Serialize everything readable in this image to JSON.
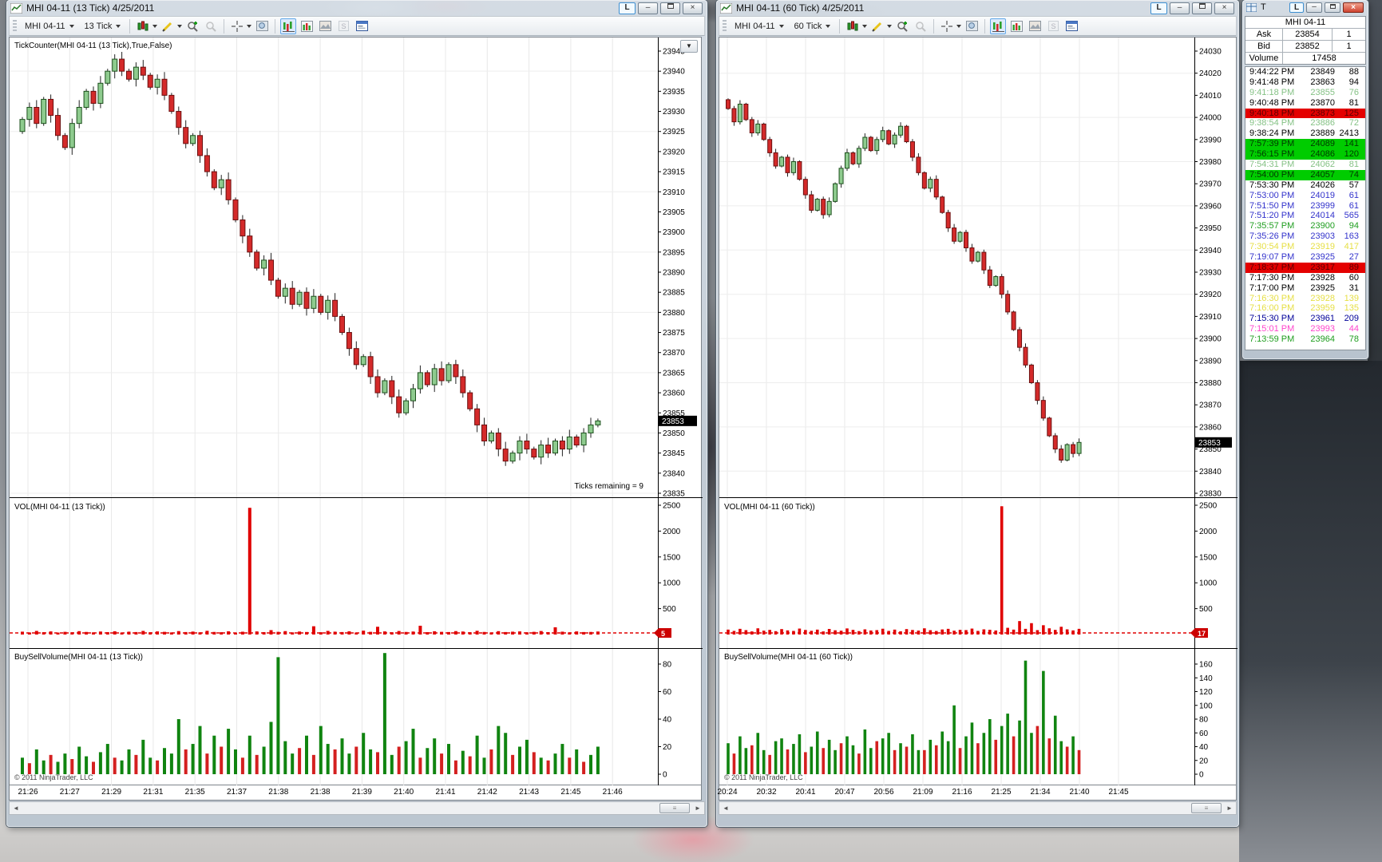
{
  "chrome": {
    "link_label": "L",
    "minimize_glyph": "–",
    "close_glyph": "×",
    "axis_menu_glyph": "▼",
    "scroll_left_glyph": "◄",
    "scroll_right_glyph": "►",
    "scroll_grip_glyph": "≡"
  },
  "colors": {
    "candle_up": "#8ecb8e",
    "candle_up_stroke": "#1c4f1c",
    "candle_down": "#d42a2a",
    "candle_down_stroke": "#6b0f0f",
    "wick": "#222222",
    "volume_bar": "#e00000",
    "buy_bar": "#108410",
    "sell_bar": "#d42020",
    "grid": "#e8e8e8",
    "price_badge_bg": "#000000",
    "vol_badge_bg": "#cc0000"
  },
  "left_chart": {
    "title": "MHI 04-11 (13 Tick)  4/25/2011",
    "toolbar": {
      "instrument": "MHI 04-11",
      "interval": "13 Tick"
    },
    "indicator_label": "TickCounter(MHI 04-11 (13 Tick),True,False)",
    "vol_label": "VOL(MHI 04-11 (13 Tick))",
    "bsv_label": "BuySellVolume(MHI 04-11 (13 Tick))",
    "ticks_remaining": "Ticks remaining = 9",
    "copyright": "© 2011 NinjaTrader, LLC",
    "price_axis": {
      "max": 23945,
      "min": 23835,
      "step": 5
    },
    "last_price": "23853",
    "vol_axis": {
      "max": 2500,
      "step": 500,
      "last": "5"
    },
    "bsv_axis": {
      "max": 80,
      "step": 20
    },
    "time_labels": [
      "21:26",
      "21:27",
      "21:29",
      "21:31",
      "21:35",
      "21:37",
      "21:38",
      "21:38",
      "21:39",
      "21:40",
      "21:41",
      "21:42",
      "21:43",
      "21:45",
      "21:46"
    ],
    "open_first": 23925,
    "closes": [
      23928,
      23931,
      23927,
      23933,
      23929,
      23924,
      23921,
      23927,
      23931,
      23935,
      23932,
      23937,
      23940,
      23943,
      23940,
      23938,
      23941,
      23939,
      23936,
      23938,
      23934,
      23930,
      23926,
      23922,
      23924,
      23919,
      23915,
      23911,
      23913,
      23908,
      23903,
      23899,
      23895,
      23891,
      23893,
      23888,
      23884,
      23886,
      23882,
      23885,
      23881,
      23884,
      23880,
      23883,
      23879,
      23875,
      23871,
      23867,
      23869,
      23864,
      23860,
      23863,
      23859,
      23855,
      23858,
      23861,
      23865,
      23862,
      23866,
      23863,
      23867,
      23864,
      23860,
      23856,
      23852,
      23848,
      23850,
      23846,
      23843,
      23845,
      23848,
      23846,
      23844,
      23847,
      23845,
      23848,
      23846,
      23849,
      23847,
      23850,
      23852,
      23853
    ],
    "volumes": [
      55,
      40,
      70,
      45,
      60,
      38,
      52,
      44,
      65,
      50,
      42,
      58,
      47,
      63,
      39,
      55,
      48,
      70,
      44,
      60,
      52,
      41,
      66,
      48,
      57,
      43,
      72,
      50,
      45,
      62,
      38,
      54,
      2450,
      60,
      47,
      85,
      52,
      66,
      42,
      58,
      49,
      160,
      45,
      70,
      55,
      48,
      62,
      40,
      75,
      52,
      150,
      60,
      44,
      68,
      50,
      58,
      170,
      46,
      63,
      52,
      48,
      66,
      58,
      45,
      72,
      50,
      40,
      65,
      48,
      55,
      60,
      44,
      52,
      68,
      47,
      140,
      55,
      42,
      60,
      48,
      50,
      58
    ],
    "bsv": [
      12,
      -8,
      18,
      10,
      -14,
      9,
      15,
      -11,
      20,
      13,
      -9,
      16,
      22,
      -12,
      10,
      18,
      -14,
      25,
      12,
      -10,
      19,
      15,
      40,
      -18,
      22,
      35,
      -15,
      28,
      -20,
      33,
      18,
      -12,
      28,
      -14,
      20,
      38,
      85,
      24,
      15,
      -19,
      28,
      -14,
      35,
      22,
      -18,
      26,
      15,
      -20,
      30,
      18,
      -16,
      88,
      14,
      -20,
      24,
      33,
      -12,
      19,
      26,
      -15,
      22,
      -10,
      17,
      -13,
      28,
      12,
      -18,
      35,
      30,
      -14,
      20,
      25,
      -16,
      12,
      -10,
      15,
      22,
      -12,
      18,
      -9,
      14,
      20
    ]
  },
  "right_chart": {
    "title": "MHI 04-11 (60 Tick)  4/25/2011",
    "toolbar": {
      "instrument": "MHI 04-11",
      "interval": "60 Tick"
    },
    "vol_label": "VOL(MHI 04-11 (60 Tick))",
    "bsv_label": "BuySellVolume(MHI 04-11 (60 Tick))",
    "copyright": "© 2011 NinjaTrader, LLC",
    "price_axis": {
      "max": 24030,
      "min": 23830,
      "step": 10
    },
    "last_price": "23853",
    "vol_axis": {
      "max": 2500,
      "step": 500,
      "last": "17"
    },
    "bsv_axis": {
      "max": 160,
      "step": 20
    },
    "time_labels": [
      "20:24",
      "20:32",
      "20:41",
      "20:47",
      "20:56",
      "21:09",
      "21:16",
      "21:25",
      "21:34",
      "21:40",
      "21:45"
    ],
    "open_first": 24008,
    "closes": [
      24004,
      23998,
      24006,
      23999,
      23993,
      23997,
      23990,
      23984,
      23978,
      23982,
      23975,
      23980,
      23972,
      23965,
      23958,
      23963,
      23956,
      23962,
      23970,
      23977,
      23984,
      23979,
      23986,
      23991,
      23985,
      23990,
      23994,
      23988,
      23992,
      23996,
      23989,
      23982,
      23975,
      23968,
      23972,
      23964,
      23957,
      23950,
      23944,
      23948,
      23941,
      23935,
      23939,
      23931,
      23924,
      23928,
      23920,
      23912,
      23904,
      23896,
      23888,
      23880,
      23872,
      23864,
      23856,
      23850,
      23845,
      23852,
      23848,
      23853
    ],
    "volumes": [
      95,
      70,
      110,
      85,
      60,
      120,
      75,
      90,
      65,
      105,
      80,
      70,
      115,
      88,
      72,
      95,
      60,
      108,
      82,
      74,
      118,
      90,
      66,
      100,
      78,
      85,
      112,
      70,
      95,
      62,
      105,
      88,
      76,
      120,
      84,
      68,
      98,
      110,
      74,
      90,
      86,
      115,
      70,
      100,
      92,
      78,
      2480,
      130,
      95,
      260,
      110,
      220,
      85,
      180,
      120,
      90,
      150,
      100,
      80,
      110
    ],
    "bsv": [
      45,
      -30,
      55,
      38,
      -42,
      60,
      35,
      -28,
      48,
      52,
      -36,
      44,
      58,
      -32,
      40,
      62,
      -38,
      50,
      35,
      -45,
      55,
      42,
      -30,
      65,
      38,
      -48,
      52,
      60,
      -35,
      45,
      -40,
      58,
      35,
      -35,
      50,
      -42,
      62,
      48,
      100,
      -38,
      55,
      75,
      -45,
      60,
      80,
      -50,
      70,
      88,
      -55,
      78,
      165,
      60,
      -70,
      150,
      -52,
      85,
      48,
      -40,
      55,
      -35
    ]
  },
  "tns": {
    "title": "T",
    "instrument": "MHI 04-11",
    "ask_label": "Ask",
    "ask": "23854",
    "ask_size": "1",
    "bid_label": "Bid",
    "bid": "23852",
    "bid_size": "1",
    "volume_label": "Volume",
    "volume": "17458",
    "rows": [
      {
        "t": "9:44:22 PM",
        "p": "23849",
        "s": "88",
        "c": "k"
      },
      {
        "t": "9:41:48 PM",
        "p": "23863",
        "s": "94",
        "c": "k"
      },
      {
        "t": "9:41:18 PM",
        "p": "23855",
        "s": "76",
        "c": "pg"
      },
      {
        "t": "9:40:48 PM",
        "p": "23870",
        "s": "81",
        "c": "k"
      },
      {
        "t": "9:40:18 PM",
        "p": "23873",
        "s": "125",
        "c": "rbg"
      },
      {
        "t": "9:38:54 PM",
        "p": "23886",
        "s": "72",
        "c": "pg"
      },
      {
        "t": "9:38:24 PM",
        "p": "23889",
        "s": "2413",
        "c": "k"
      },
      {
        "t": "7:57:39 PM",
        "p": "24089",
        "s": "141",
        "c": "gbg"
      },
      {
        "t": "7:56:15 PM",
        "p": "24086",
        "s": "120",
        "c": "gbg"
      },
      {
        "t": "7:54:31 PM",
        "p": "24062",
        "s": "81",
        "c": "pg"
      },
      {
        "t": "7:54:00 PM",
        "p": "24057",
        "s": "74",
        "c": "gbg"
      },
      {
        "t": "7:53:30 PM",
        "p": "24026",
        "s": "57",
        "c": "k"
      },
      {
        "t": "7:53:00 PM",
        "p": "24019",
        "s": "61",
        "c": "bl"
      },
      {
        "t": "7:51:50 PM",
        "p": "23999",
        "s": "61",
        "c": "bl"
      },
      {
        "t": "7:51:20 PM",
        "p": "24014",
        "s": "565",
        "c": "bl"
      },
      {
        "t": "7:35:57 PM",
        "p": "23900",
        "s": "94",
        "c": "gr"
      },
      {
        "t": "7:35:26 PM",
        "p": "23903",
        "s": "163",
        "c": "bl"
      },
      {
        "t": "7:30:54 PM",
        "p": "23919",
        "s": "417",
        "c": "yl"
      },
      {
        "t": "7:19:07 PM",
        "p": "23925",
        "s": "27",
        "c": "bl"
      },
      {
        "t": "7:18:37 PM",
        "p": "23917",
        "s": "89",
        "c": "rbg"
      },
      {
        "t": "7:17:30 PM",
        "p": "23928",
        "s": "60",
        "c": "k"
      },
      {
        "t": "7:17:00 PM",
        "p": "23925",
        "s": "31",
        "c": "k"
      },
      {
        "t": "7:16:30 PM",
        "p": "23928",
        "s": "139",
        "c": "yl"
      },
      {
        "t": "7:16:00 PM",
        "p": "23959",
        "s": "135",
        "c": "yl"
      },
      {
        "t": "7:15:30 PM",
        "p": "23961",
        "s": "209",
        "c": "nv"
      },
      {
        "t": "7:15:01 PM",
        "p": "23993",
        "s": "44",
        "c": "mg"
      },
      {
        "t": "7:13:59 PM",
        "p": "23964",
        "s": "78",
        "c": "gr"
      }
    ]
  }
}
